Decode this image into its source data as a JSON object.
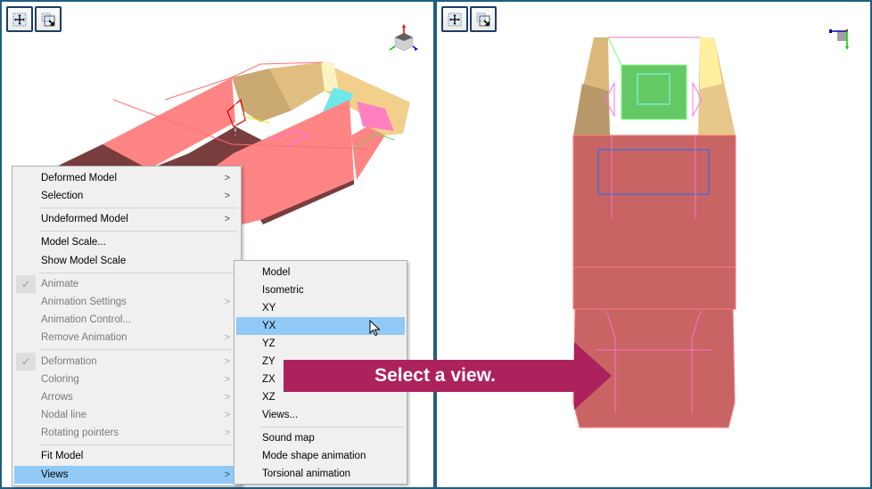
{
  "viewports": {
    "left": {
      "name": "3D isometric model view",
      "toolbar": [
        {
          "icon": "zoom-extents-icon",
          "tooltip": ""
        },
        {
          "icon": "zoom-window-icon",
          "tooltip": ""
        }
      ],
      "triad": "axis-triad-isometric"
    },
    "right": {
      "name": "YX plane model view",
      "toolbar": [
        {
          "icon": "zoom-extents-icon",
          "tooltip": ""
        },
        {
          "icon": "zoom-window-icon",
          "tooltip": ""
        }
      ],
      "triad": "axis-triad-yx"
    }
  },
  "context_menu": {
    "items": [
      {
        "label": "Deformed Model",
        "submenu": true,
        "disabled": false,
        "checked": false
      },
      {
        "label": "Selection",
        "submenu": true,
        "disabled": false,
        "checked": false
      },
      {
        "label": "Undeformed Model",
        "submenu": true,
        "disabled": false,
        "checked": false
      },
      {
        "label": "Model Scale...",
        "submenu": false,
        "disabled": false,
        "checked": false
      },
      {
        "label": "Show Model Scale",
        "submenu": false,
        "disabled": false,
        "checked": false
      },
      {
        "label": "Animate",
        "submenu": false,
        "disabled": true,
        "checked": true
      },
      {
        "label": "Animation Settings",
        "submenu": true,
        "disabled": true,
        "checked": false
      },
      {
        "label": "Animation Control...",
        "submenu": false,
        "disabled": true,
        "checked": false
      },
      {
        "label": "Remove Animation",
        "submenu": true,
        "disabled": true,
        "checked": false
      },
      {
        "label": "Deformation",
        "submenu": true,
        "disabled": true,
        "checked": true
      },
      {
        "label": "Coloring",
        "submenu": true,
        "disabled": true,
        "checked": false
      },
      {
        "label": "Arrows",
        "submenu": true,
        "disabled": true,
        "checked": false
      },
      {
        "label": "Nodal line",
        "submenu": true,
        "disabled": true,
        "checked": false
      },
      {
        "label": "Rotating pointers",
        "submenu": true,
        "disabled": true,
        "checked": false
      },
      {
        "label": "Fit Model",
        "submenu": false,
        "disabled": false,
        "checked": false
      },
      {
        "label": "Views",
        "submenu": true,
        "disabled": false,
        "checked": false,
        "highlighted": true
      }
    ],
    "submenu_arrow": ">",
    "check_glyph": "✓"
  },
  "views_submenu": {
    "items": [
      {
        "label": "Model"
      },
      {
        "label": "Isometric"
      },
      {
        "label": "XY"
      },
      {
        "label": "YX",
        "highlighted": true
      },
      {
        "label": "YZ"
      },
      {
        "label": "ZY"
      },
      {
        "label": "ZX"
      },
      {
        "label": "XZ"
      },
      {
        "label": "Views..."
      },
      {
        "label": "Sound map"
      },
      {
        "label": "Mode shape animation"
      },
      {
        "label": "Torsional animation"
      }
    ]
  },
  "callout": {
    "text": "Select a view.",
    "color": "#ad215c"
  },
  "colors": {
    "menu_highlight": "#91c9f7",
    "viewport_border": "#1f5f7f",
    "model_body": "#c86464",
    "model_body_light": "#ff8585",
    "model_body_dark": "#7a3d3d",
    "model_tan": "#e8c88a",
    "model_green": "#64c864",
    "model_cyan": "#70e8e8"
  }
}
